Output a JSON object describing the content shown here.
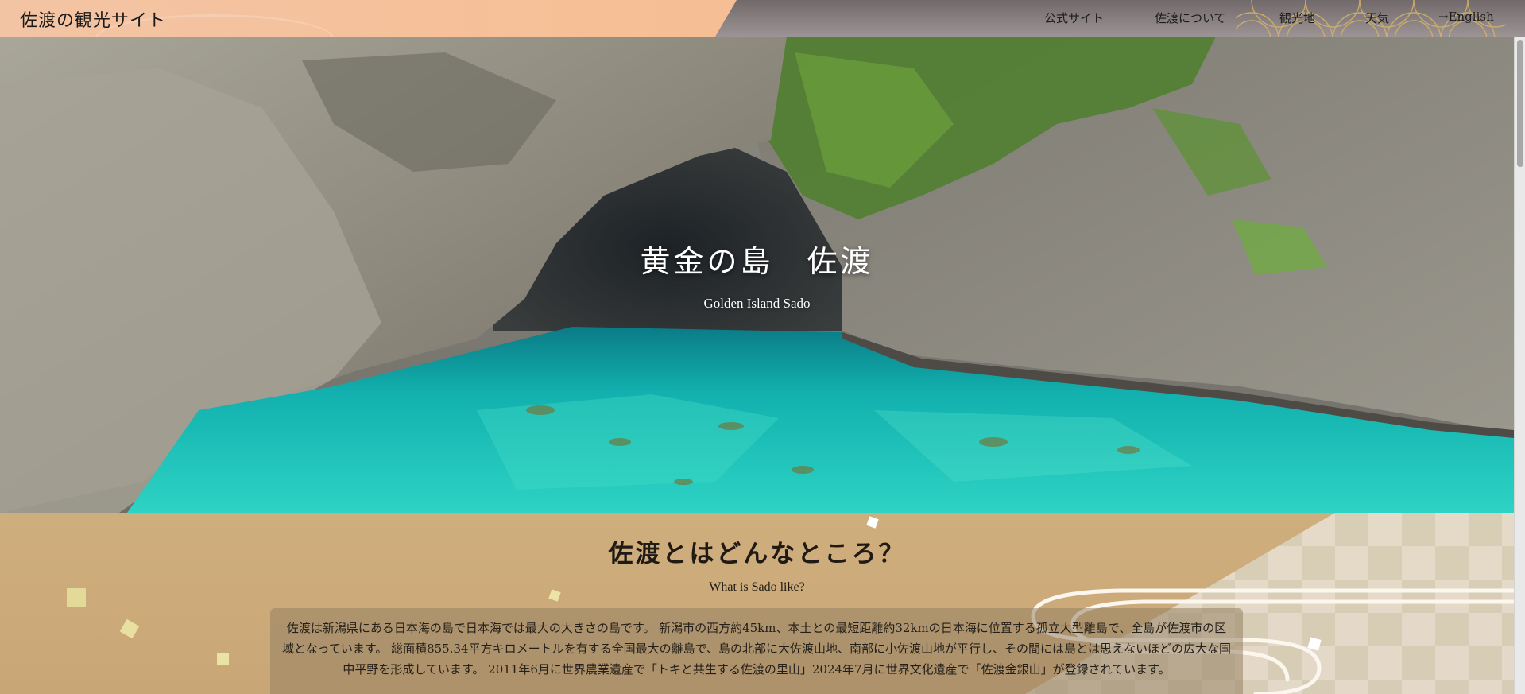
{
  "header": {
    "site_title": "佐渡の観光サイト",
    "nav": {
      "official": "公式サイト",
      "about": "佐渡について",
      "spots": "観光地",
      "weather": "天気",
      "english": "→English"
    }
  },
  "hero": {
    "title": "黄金の島　佐渡",
    "subtitle": "Golden Island Sado"
  },
  "intro": {
    "title": "佐渡とはどんなところ？",
    "subtitle": "What is Sado like?",
    "body": "佐渡は新潟県にある日本海の島で日本海では最大の大きさの島です。 新潟市の西方約45km、本土との最短距離約32kmの日本海に位置する孤立大型離島で、全島が佐渡市の区域となっています。 総面積855.34平方キロメートルを有する全国最大の離島で、島の北部に大佐渡山地、南部に小佐渡山地が平行し、その間には島とは思えないほどの広大な国中平野を形成しています。 2011年6月に世界農業遺産で「トキと共生する佐渡の里山」2024年7月に世界文化遺産で「佐渡金銀山」が登録されています。"
  },
  "colors": {
    "header_peach": "#f5bc90",
    "header_gray": "#847c7c",
    "section_gold": "#cbaa79",
    "water_teal": "#1fc3bf"
  },
  "icons": {
    "english_arrow": "arrow-right-icon"
  }
}
